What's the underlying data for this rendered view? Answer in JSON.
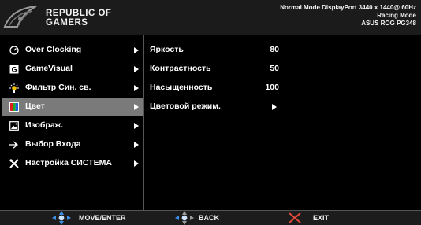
{
  "header": {
    "brand_line1": "REPUBLIC OF",
    "brand_line2": "GAMERS",
    "status_line1": "Normal Mode DisplayPort 3440 x 1440@ 60Hz",
    "status_line2": "Racing Mode",
    "status_line3": "ASUS ROG PG348"
  },
  "menu": {
    "items": [
      {
        "label": "Over Clocking",
        "icon": "speedometer-icon"
      },
      {
        "label": "GameVisual",
        "icon": "gamevisual-icon"
      },
      {
        "label": "Фильтр Син. св.",
        "icon": "bulb-icon"
      },
      {
        "label": "Цвет",
        "icon": "color-palette-icon",
        "selected": true
      },
      {
        "label": "Изображ.",
        "icon": "image-icon"
      },
      {
        "label": "Выбор Входа",
        "icon": "input-icon"
      },
      {
        "label": "Настройка СИСТЕМА",
        "icon": "tools-icon"
      }
    ]
  },
  "submenu": {
    "items": [
      {
        "label": "Яркость",
        "value": "80"
      },
      {
        "label": "Контрастность",
        "value": "50"
      },
      {
        "label": "Насыщенность",
        "value": "100"
      },
      {
        "label": "Цветовой режим.",
        "value": ""
      }
    ]
  },
  "footer": {
    "move_enter": "MOVE/ENTER",
    "back": "BACK",
    "exit": "EXIT"
  },
  "colors": {
    "background": "#000000",
    "header_bg": "#1b1b1b",
    "selected_bg": "#7a7a7a",
    "divider": "#555555",
    "nav_blue": "#3a8ee6",
    "exit_red": "#e04a3a"
  }
}
